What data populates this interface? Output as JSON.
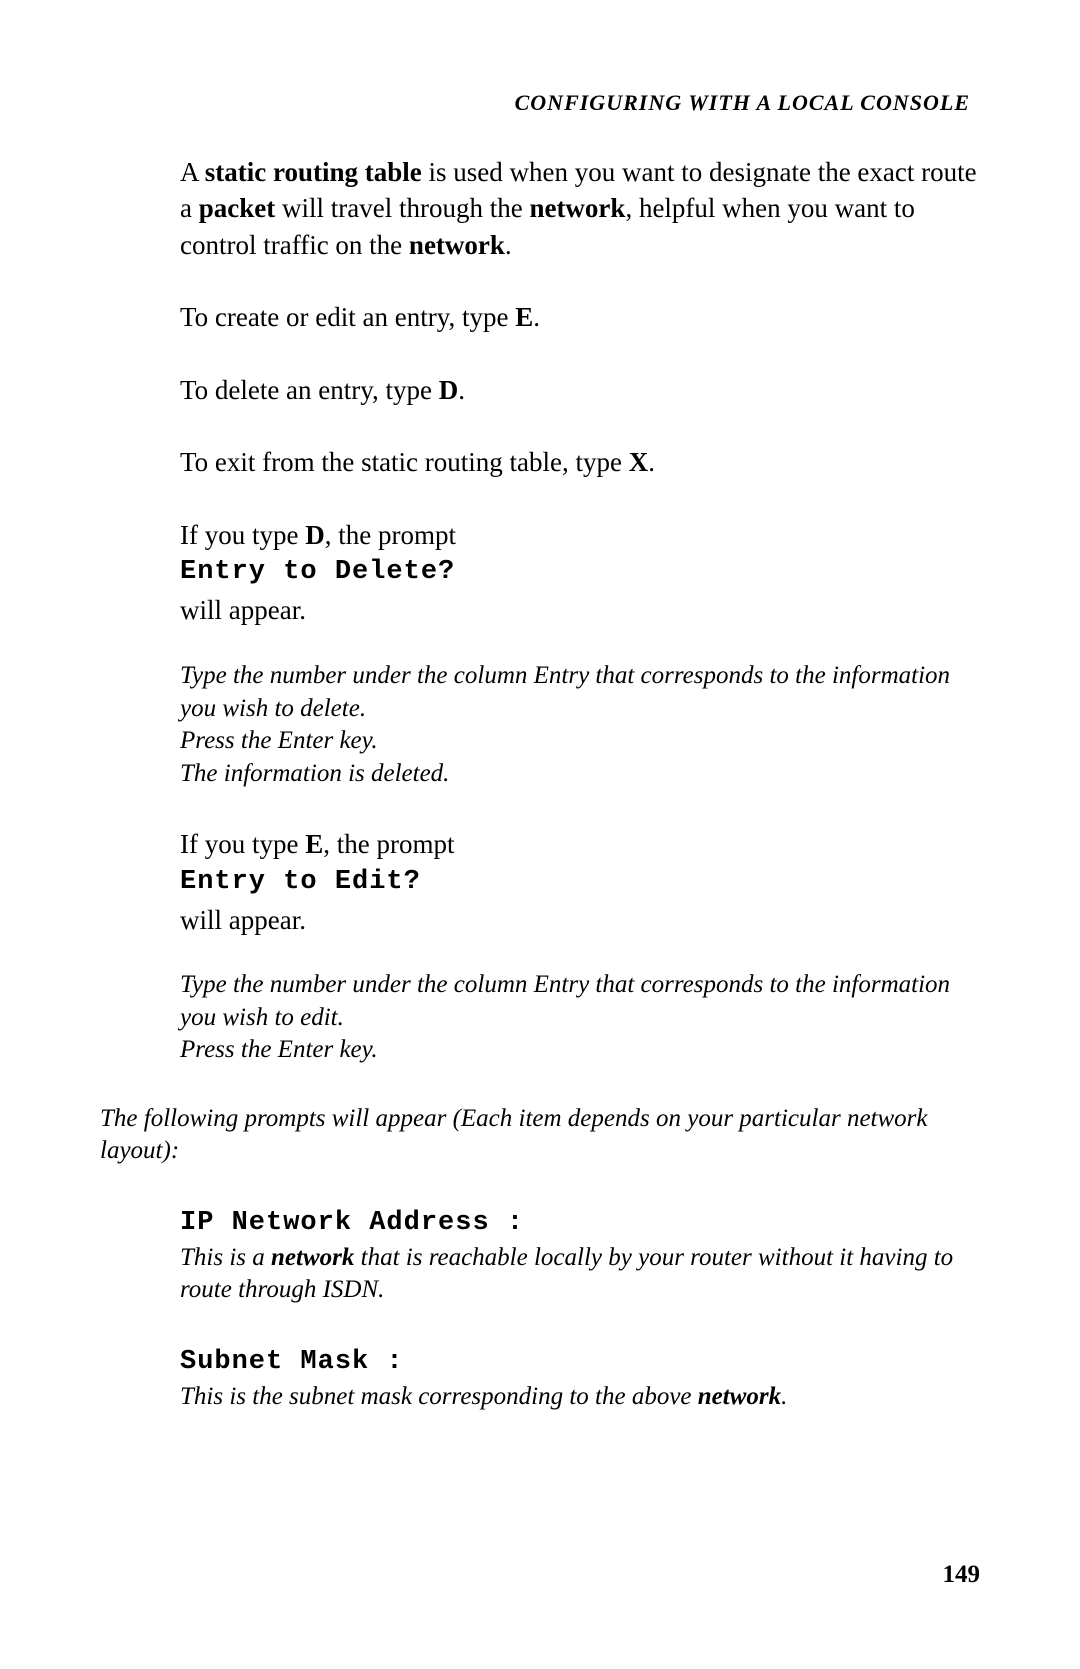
{
  "header": "CONFIGURING WITH A LOCAL CONSOLE",
  "para1": {
    "t1": "A ",
    "b1": "static routing table",
    "t2": " is used when you want to designate the exact route a ",
    "b2": "packet",
    "t3": " will travel through the ",
    "b3": "network",
    "t4": ", helpful when you want to control traffic on the ",
    "b4": "network",
    "t5": "."
  },
  "para2": {
    "t1": "To create or edit an entry, type ",
    "b1": "E",
    "t2": "."
  },
  "para3": {
    "t1": "To delete an entry, type ",
    "b1": "D",
    "t2": "."
  },
  "para4": {
    "t1": "To exit from the static routing table, type ",
    "b1": "X",
    "t2": "."
  },
  "promptD": {
    "line1a": "If you type ",
    "line1b": "D",
    "line1c": ", the prompt",
    "mono": "Entry to Delete?",
    "line3": "will appear."
  },
  "italicD": {
    "l1": "Type the number under the column Entry that corresponds to the information you wish to delete.",
    "l2": "Press the Enter key.",
    "l3": "The information is deleted."
  },
  "promptE": {
    "line1a": "If you type ",
    "line1b": "E",
    "line1c": ", the prompt",
    "mono": "Entry to Edit?",
    "line3": "will appear."
  },
  "italicE": {
    "l1": "Type the number under the column Entry that corresponds to the information you wish to edit.",
    "l2": "Press the Enter key."
  },
  "fullWidth": "The following prompts will appear (Each item depends on your particular network layout):",
  "ipNetwork": {
    "heading": "IP Network Address :",
    "d1": "This is a ",
    "db": "network",
    "d2": " that is reachable locally by your router without it having to route through ISDN."
  },
  "subnet": {
    "heading": "Subnet Mask :",
    "d1": "This is the subnet mask corresponding to the above ",
    "db": "network",
    "d2": "."
  },
  "pageNumber": "149"
}
